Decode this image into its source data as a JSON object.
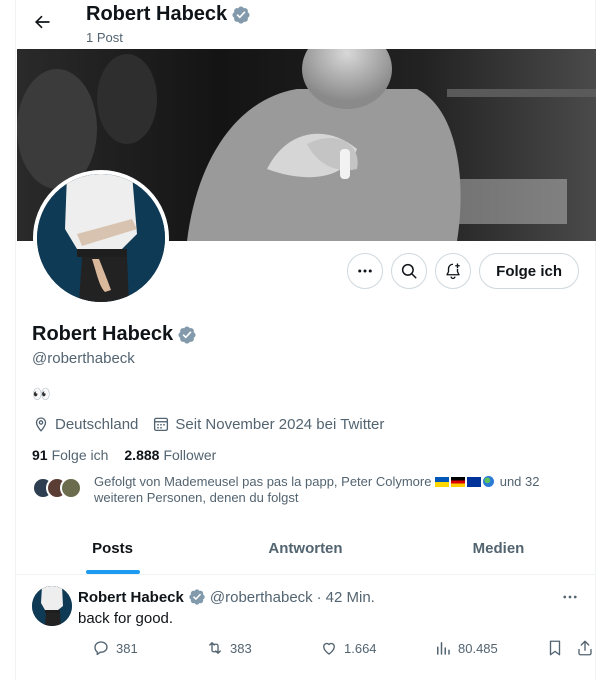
{
  "header": {
    "title": "Robert Habeck",
    "post_count": "1 Post"
  },
  "actions": {
    "follow_label": "Folge ich"
  },
  "profile": {
    "name": "Robert Habeck",
    "handle": "@roberthabeck",
    "bio": "👀",
    "location": "Deutschland",
    "joined": "Seit November 2024 bei Twitter",
    "following_count": "91",
    "following_label": "Folge ich",
    "followers_count": "2.888",
    "followers_label": "Follower",
    "followed_by_prefix": "Gefolgt von Mademeusel pas pas la papp, Peter Colymore",
    "followed_by_suffix": "und 32 weiteren Personen, denen du folgst"
  },
  "tabs": [
    {
      "label": "Posts",
      "active": true
    },
    {
      "label": "Antworten",
      "active": false
    },
    {
      "label": "Medien",
      "active": false
    }
  ],
  "tweet": {
    "name": "Robert Habeck",
    "handle": "@roberthabeck",
    "separator": "·",
    "time": "42 Min.",
    "text": "back for good.",
    "replies": "381",
    "reposts": "383",
    "likes": "1.664",
    "views": "80.485"
  },
  "colors": {
    "accent": "#1d9bf0",
    "verified": "#829aab",
    "text": "#0f1419",
    "muted": "#536471",
    "border": "#cfd9de"
  },
  "icons": [
    "back-arrow-icon",
    "verified-badge-icon",
    "more-icon",
    "search-icon",
    "notification-bell-icon",
    "location-pin-icon",
    "calendar-icon",
    "reply-icon",
    "repost-icon",
    "like-icon",
    "views-icon",
    "bookmark-icon",
    "share-icon"
  ]
}
